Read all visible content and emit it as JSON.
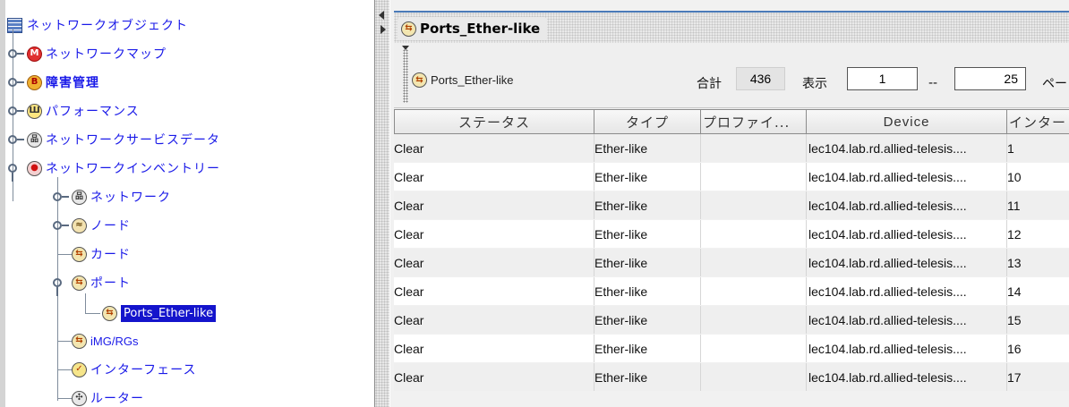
{
  "tree": {
    "root": {
      "label": "ネットワークオブジェクト",
      "icon": "folder-list-icon"
    },
    "items": [
      {
        "label": "ネットワークマップ",
        "icon": "network-map-icon",
        "glyph": "M"
      },
      {
        "label": "障害管理",
        "icon": "fault-management-icon",
        "glyph": "B"
      },
      {
        "label": "パフォーマンス",
        "icon": "performance-chart-icon",
        "glyph": "Ш"
      },
      {
        "label": "ネットワークサービスデータ",
        "icon": "network-service-data-icon",
        "glyph": "品"
      },
      {
        "label": "ネットワークインベントリー",
        "icon": "network-inventory-icon",
        "glyph": "●"
      },
      {
        "label": "ネットワーク",
        "icon": "network-icon",
        "glyph": "品"
      },
      {
        "label": "ノード",
        "icon": "node-icon",
        "glyph": "≈"
      },
      {
        "label": "カード",
        "icon": "card-icon",
        "glyph": "⇆"
      },
      {
        "label": "ポート",
        "icon": "port-icon",
        "glyph": "⇆"
      },
      {
        "label": "Ports_Ether-like",
        "icon": "port-icon",
        "glyph": "⇆"
      },
      {
        "label": "iMG/RGs",
        "icon": "img-rg-icon",
        "glyph": "⇆"
      },
      {
        "label": "インターフェース",
        "icon": "interface-icon",
        "glyph": "✓"
      },
      {
        "label": "ルーター",
        "icon": "router-icon",
        "glyph": "✣"
      }
    ]
  },
  "frame": {
    "title": "Ports_Ether-like",
    "icon": "port-icon"
  },
  "toolbar": {
    "name": "Ports_Ether-like",
    "total_label": "合計",
    "total_value": "436",
    "display_label": "表示",
    "from_value": "1",
    "separator": "--",
    "to_value": "25",
    "page_label": "ペー"
  },
  "table": {
    "columns": [
      "ステータス",
      "タイプ",
      "プロファイ...",
      "Device",
      "インター"
    ],
    "rows": [
      [
        "Clear",
        "Ether-like",
        "",
        "lec104.lab.rd.allied-telesis....",
        "1"
      ],
      [
        "Clear",
        "Ether-like",
        "",
        "lec104.lab.rd.allied-telesis....",
        "10"
      ],
      [
        "Clear",
        "Ether-like",
        "",
        "lec104.lab.rd.allied-telesis....",
        "11"
      ],
      [
        "Clear",
        "Ether-like",
        "",
        "lec104.lab.rd.allied-telesis....",
        "12"
      ],
      [
        "Clear",
        "Ether-like",
        "",
        "lec104.lab.rd.allied-telesis....",
        "13"
      ],
      [
        "Clear",
        "Ether-like",
        "",
        "lec104.lab.rd.allied-telesis....",
        "14"
      ],
      [
        "Clear",
        "Ether-like",
        "",
        "lec104.lab.rd.allied-telesis....",
        "15"
      ],
      [
        "Clear",
        "Ether-like",
        "",
        "lec104.lab.rd.allied-telesis....",
        "16"
      ],
      [
        "Clear",
        "Ether-like",
        "",
        "lec104.lab.rd.allied-telesis....",
        "17"
      ]
    ]
  },
  "colors": {
    "tree_link": "#1a1ae8",
    "selection": "#1414cc",
    "frame_accent": "#4a7ab8"
  }
}
